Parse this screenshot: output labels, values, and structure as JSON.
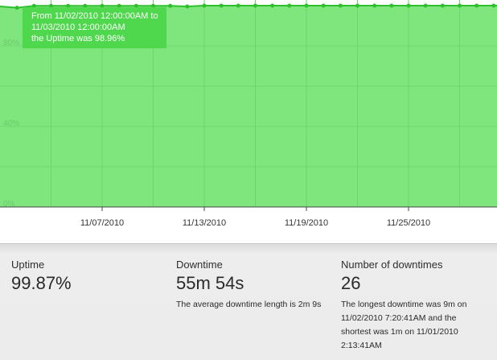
{
  "chart_data": {
    "type": "area",
    "x_tick_labels": [
      "11/07/2010",
      "11/13/2010",
      "11/19/2010",
      "11/25/2010"
    ],
    "y_tick_labels": [
      "80%",
      "40%",
      "0%"
    ],
    "ylim": [
      0,
      100
    ],
    "xlim": [
      "11/01/2010",
      "12/01/2010"
    ],
    "grid": true,
    "series": [
      {
        "x": [
          "11/01/2010",
          "11/02/2010",
          "11/03/2010",
          "11/04/2010",
          "11/05/2010",
          "11/06/2010",
          "11/07/2010",
          "11/08/2010",
          "11/09/2010",
          "11/10/2010",
          "11/11/2010",
          "11/12/2010",
          "11/13/2010",
          "11/14/2010",
          "11/15/2010",
          "11/16/2010",
          "11/17/2010",
          "11/18/2010",
          "11/19/2010",
          "11/20/2010",
          "11/21/2010",
          "11/22/2010",
          "11/23/2010",
          "11/24/2010",
          "11/25/2010",
          "11/26/2010",
          "11/27/2010",
          "11/28/2010",
          "11/29/2010",
          "11/30/2010"
        ],
        "values": [
          99.6,
          98.96,
          99.9,
          99.9,
          99.9,
          99.9,
          99.9,
          99.9,
          99.9,
          99.9,
          99.9,
          99.6,
          100,
          100,
          100,
          100,
          100,
          100,
          100,
          100,
          100,
          100,
          100,
          100,
          100,
          100,
          100,
          100,
          100,
          100
        ]
      }
    ],
    "colors": {
      "fill": "#7fe67e",
      "line": "#2ec02b",
      "grid": "#6cd56b",
      "axis_text": "#6ac96b"
    }
  },
  "tooltip": {
    "line1": "From 11/02/2010 12:00:00AM to",
    "line2": "11/03/2010 12:00:00AM",
    "line3": "the Uptime was 98.96%"
  },
  "stats": {
    "uptime": {
      "label": "Uptime",
      "value": "99.87%"
    },
    "downtime": {
      "label": "Downtime",
      "value": "55m 54s",
      "note": "The average downtime length is 2m 9s"
    },
    "downtimes_count": {
      "label": "Number of downtimes",
      "value": "26",
      "note": "The longest downtime was 9m on 11/02/2010 7:20:41AM and the shortest was 1m on 11/01/2010 2:13:41AM"
    }
  }
}
